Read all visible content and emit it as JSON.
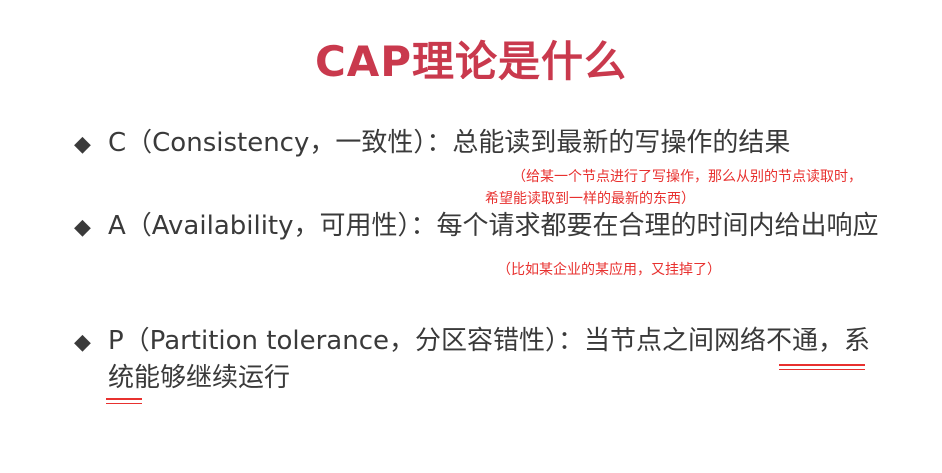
{
  "title": "CAP理论是什么",
  "bullets": [
    {
      "marker": "◆",
      "text": "C（Consistency，一致性）：总能读到最新的写操作的结果"
    },
    {
      "marker": "◆",
      "text": "A（Availability，可用性）：每个请求都要在合理的时间内给出响应"
    },
    {
      "marker": "◆",
      "text": "P（Partition tolerance，分区容错性）：当节点之间网络不通，系统能够继续运行"
    }
  ],
  "annotations": {
    "consistency_line1": "（给某一个节点进行了写操作，那么从别的节点读取时，",
    "consistency_line2": "希望能读取到一样的最新的东西）",
    "availability": "（比如某企业的某应用，又挂掉了）"
  },
  "colors": {
    "title": "#c9394d",
    "annotation": "#e8312f",
    "body_text": "#3a3a3a"
  }
}
